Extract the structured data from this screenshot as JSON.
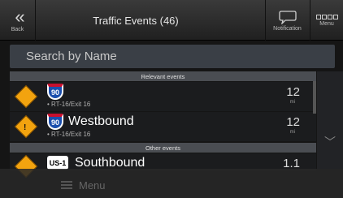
{
  "header": {
    "back_label": "Back",
    "back_glyph": "«",
    "title": "Traffic Events (46)",
    "notification_label": "Notification",
    "menu_label": "Menu"
  },
  "search": {
    "placeholder": "Search by Name"
  },
  "sections": {
    "relevant": "Relevant events",
    "other": "Other events"
  },
  "relevant_events": [
    {
      "route": "90",
      "name": "",
      "location": "• RT-16/Exit 16",
      "distance": "12",
      "unit": "mi",
      "icon": "road-work-sign-icon"
    },
    {
      "route": "90",
      "name": "Westbound",
      "location": "• RT-16/Exit 16",
      "distance": "12",
      "unit": "mi",
      "icon": "warning-sign-icon"
    }
  ],
  "other_events": [
    {
      "route": "US-1",
      "name": "Southbound",
      "distance": "1.1",
      "icon": "road-work-sign-icon"
    }
  ],
  "bottom_bar": {
    "menu_label": "Menu"
  }
}
